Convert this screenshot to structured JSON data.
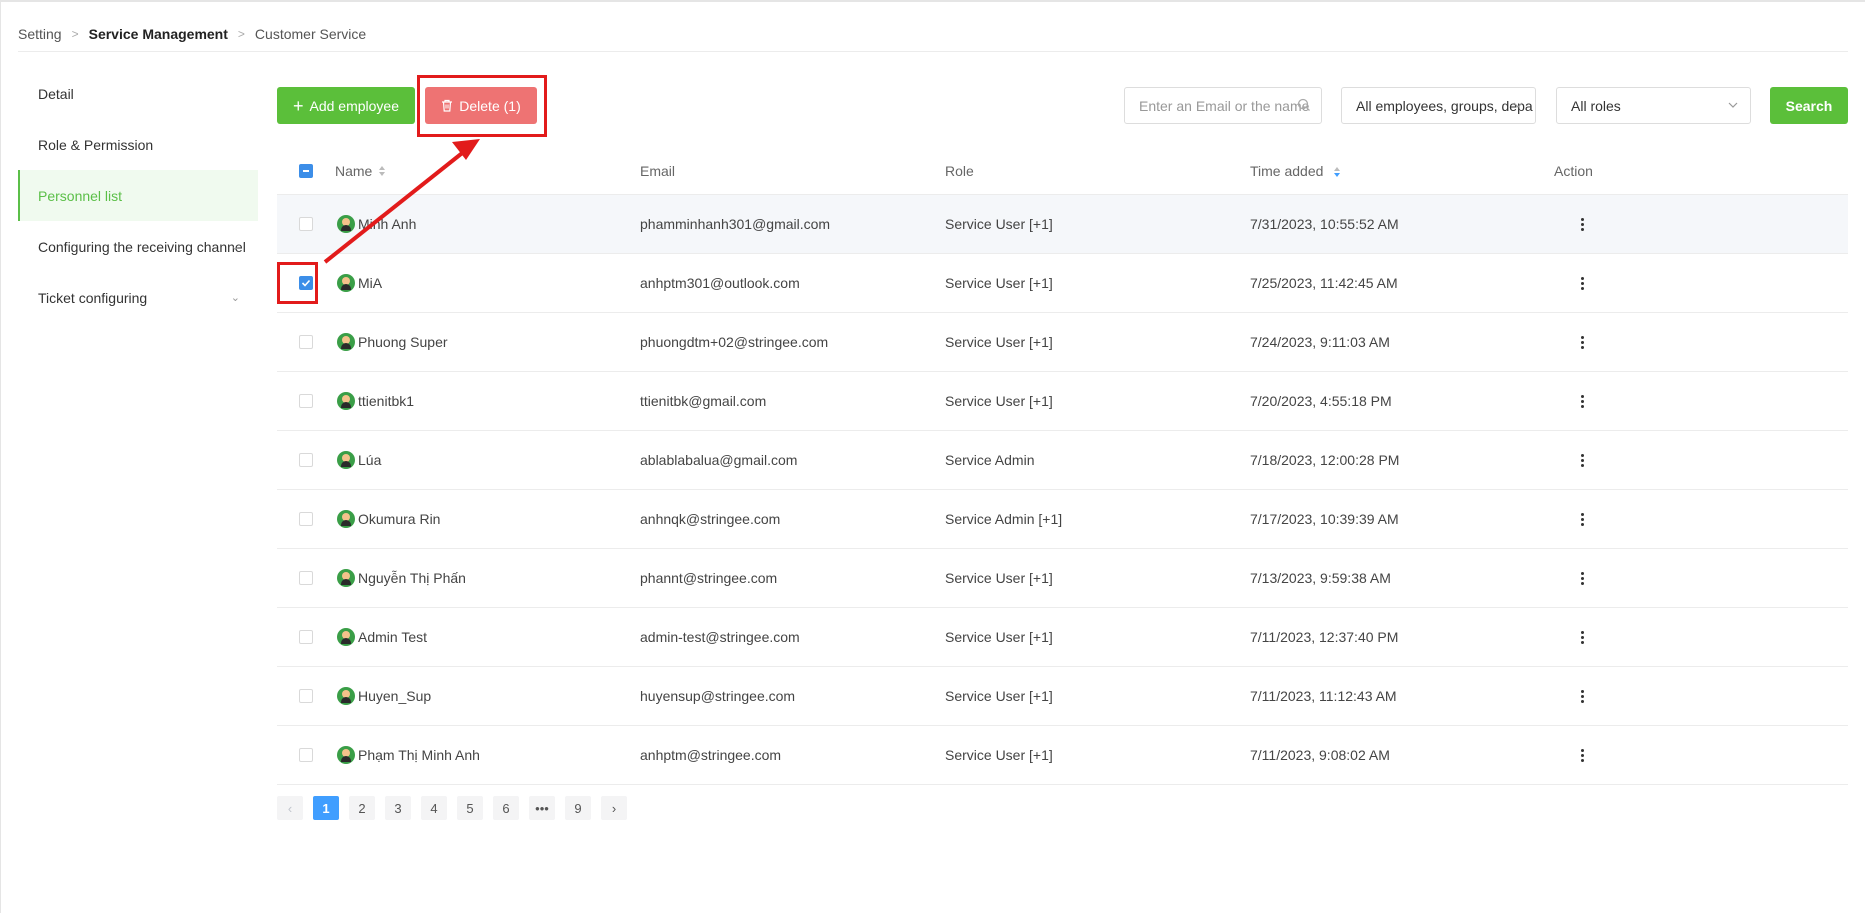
{
  "breadcrumb": {
    "item1": "Setting",
    "item2": "Service Management",
    "item3": "Customer Service"
  },
  "sidebar": {
    "items": [
      {
        "label": "Detail"
      },
      {
        "label": "Role & Permission"
      },
      {
        "label": "Personnel list"
      },
      {
        "label": "Configuring the receiving channel"
      },
      {
        "label": "Ticket configuring"
      }
    ]
  },
  "toolbar": {
    "add_label": "Add employee",
    "delete_label": "Delete (1)",
    "search_placeholder": "Enter an Email or the name",
    "groups_value": "All employees, groups, depa",
    "roles_value": "All roles",
    "search_label": "Search"
  },
  "table": {
    "headers": {
      "name": "Name",
      "email": "Email",
      "role": "Role",
      "time": "Time added",
      "action": "Action"
    },
    "rows": [
      {
        "name": "Minh Anh",
        "email": "phamminhanh301@gmail.com",
        "role": "Service User [+1]",
        "time": "7/31/2023, 10:55:52 AM",
        "checked": false
      },
      {
        "name": "MiA",
        "email": "anhptm301@outlook.com",
        "role": "Service User [+1]",
        "time": "7/25/2023, 11:42:45 AM",
        "checked": true
      },
      {
        "name": "Phuong Super",
        "email": "phuongdtm+02@stringee.com",
        "role": "Service User [+1]",
        "time": "7/24/2023, 9:11:03 AM",
        "checked": false
      },
      {
        "name": "ttienitbk1",
        "email": "ttienitbk@gmail.com",
        "role": "Service User [+1]",
        "time": "7/20/2023, 4:55:18 PM",
        "checked": false
      },
      {
        "name": "Lúa",
        "email": "ablablabalua@gmail.com",
        "role": "Service Admin",
        "time": "7/18/2023, 12:00:28 PM",
        "checked": false
      },
      {
        "name": "Okumura Rin",
        "email": "anhnqk@stringee.com",
        "role": "Service Admin [+1]",
        "time": "7/17/2023, 10:39:39 AM",
        "checked": false
      },
      {
        "name": "Nguyễn Thị Phấn",
        "email": "phannt@stringee.com",
        "role": "Service User [+1]",
        "time": "7/13/2023, 9:59:38 AM",
        "checked": false
      },
      {
        "name": "Admin Test",
        "email": "admin-test@stringee.com",
        "role": "Service User [+1]",
        "time": "7/11/2023, 12:37:40 PM",
        "checked": false
      },
      {
        "name": "Huyen_Sup",
        "email": "huyensup@stringee.com",
        "role": "Service User [+1]",
        "time": "7/11/2023, 11:12:43 AM",
        "checked": false
      },
      {
        "name": "Phạm Thị Minh Anh",
        "email": "anhptm@stringee.com",
        "role": "Service User [+1]",
        "time": "7/11/2023, 9:08:02 AM",
        "checked": false
      }
    ]
  },
  "pagination": {
    "pages": [
      "1",
      "2",
      "3",
      "4",
      "5",
      "6",
      "•••",
      "9"
    ],
    "current": "1"
  },
  "colors": {
    "primary_green": "#5bbf3a",
    "delete_red": "#ee7373",
    "annotation_red": "#e21b1b",
    "checkbox_blue": "#3c8ee8"
  }
}
